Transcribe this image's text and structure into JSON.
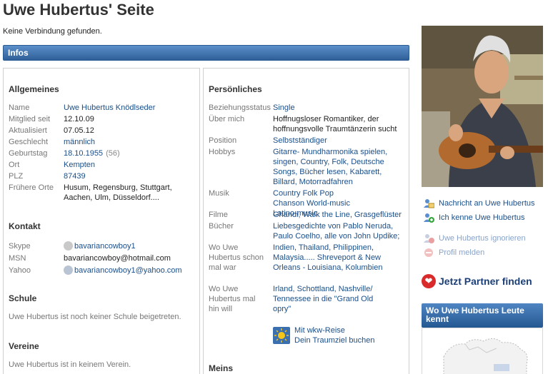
{
  "page": {
    "title": "Uwe Hubertus' Seite",
    "connection_status": "Keine Verbindung gefunden."
  },
  "infos_bar": {
    "label": "Infos"
  },
  "allgemeines": {
    "heading": "Allgemeines",
    "rows": [
      {
        "label": "Name",
        "value": "Uwe Hubertus Knödlseder",
        "link": true
      },
      {
        "label": "Mitglied seit",
        "value": "12.10.09",
        "link": false
      },
      {
        "label": "Aktualisiert",
        "value": "07.05.12",
        "link": false
      },
      {
        "label": "Geschlecht",
        "value": "männlich",
        "link": true
      },
      {
        "label": "Geburtstag",
        "value": "18.10.1955",
        "extra": "(56)",
        "link": true
      },
      {
        "label": "Ort",
        "value": "Kempten",
        "link": true
      },
      {
        "label": "PLZ",
        "value": "87439",
        "link": true
      },
      {
        "label": "Frühere Orte",
        "value": "Husum, Regensburg, Stuttgart, Aachen, Ulm, Düsseldorf....",
        "link": false
      }
    ]
  },
  "kontakt": {
    "heading": "Kontakt",
    "skype_label": "Skype",
    "skype_value": "bavariancowboy1",
    "msn_label": "MSN",
    "msn_value": "bavariancowboy@hotmail.com",
    "yahoo_label": "Yahoo",
    "yahoo_value": "bavariancowboy1@yahoo.com"
  },
  "schule": {
    "heading": "Schule",
    "text": "Uwe Hubertus ist noch keiner Schule beigetreten."
  },
  "vereine": {
    "heading": "Vereine",
    "text": "Uwe Hubertus ist in keinem Verein."
  },
  "persoenliches": {
    "heading": "Persönliches",
    "beziehung_label": "Beziehungsstatus",
    "beziehung_value": "Single",
    "ueber_label": "Über mich",
    "ueber_value": "Hoffnugsloser Romantiker, der hoffnungsvolle Traumtänzerin sucht",
    "position_label": "Position",
    "position_value": "Selbstständiger",
    "hobbys_label": "Hobbys",
    "hobbys_value": "Gitarre- Mundharmonika spielen, singen, Country, Folk, Deutsche Songs, Bücher lesen, Kabarett, Billard, Motorradfahren",
    "musik_label": "Musik",
    "musik_value": "Country Folk Pop Chanson World-music Latino-music",
    "filme_label": "Filme",
    "filme_value": "Ghandi, Walk the Line, Grasgeflüster",
    "buecher_label": "Bücher",
    "buecher_value": "Liebesgedichte von Pablo Neruda, Paulo Coelho, alle von John Updike;",
    "war_label": "Wo Uwe Hubertus schon mal war",
    "war_value": "Indien, Thailand, Philippinen, Malaysia..... Shreveport & New Orleans - Louisiana, Kolumbien",
    "will_label": "Wo Uwe Hubertus mal hin will",
    "will_value": "Irland, Schottland, Nashville/ Tennessee in die \"Grand Old opry\"",
    "reise_line1": "Mit wkw-Reise",
    "reise_line2": "Dein Traumziel buchen",
    "meins_heading": "Meins"
  },
  "sidebar": {
    "actions": [
      {
        "label": "Nachricht an Uwe Hubertus",
        "muted": false
      },
      {
        "label": "Ich kenne Uwe Hubertus",
        "muted": false
      },
      {
        "label": "Uwe Hubertus ignorieren",
        "muted": true
      },
      {
        "label": "Profil melden",
        "muted": true
      }
    ],
    "partner_label": "Jetzt Partner finden",
    "map_heading": "Wo Uwe Hubertus Leute kennt"
  },
  "colors": {
    "link": "#1a4f8a",
    "bar_blue": "#2f5f98",
    "partner_red": "#d92b2b"
  }
}
